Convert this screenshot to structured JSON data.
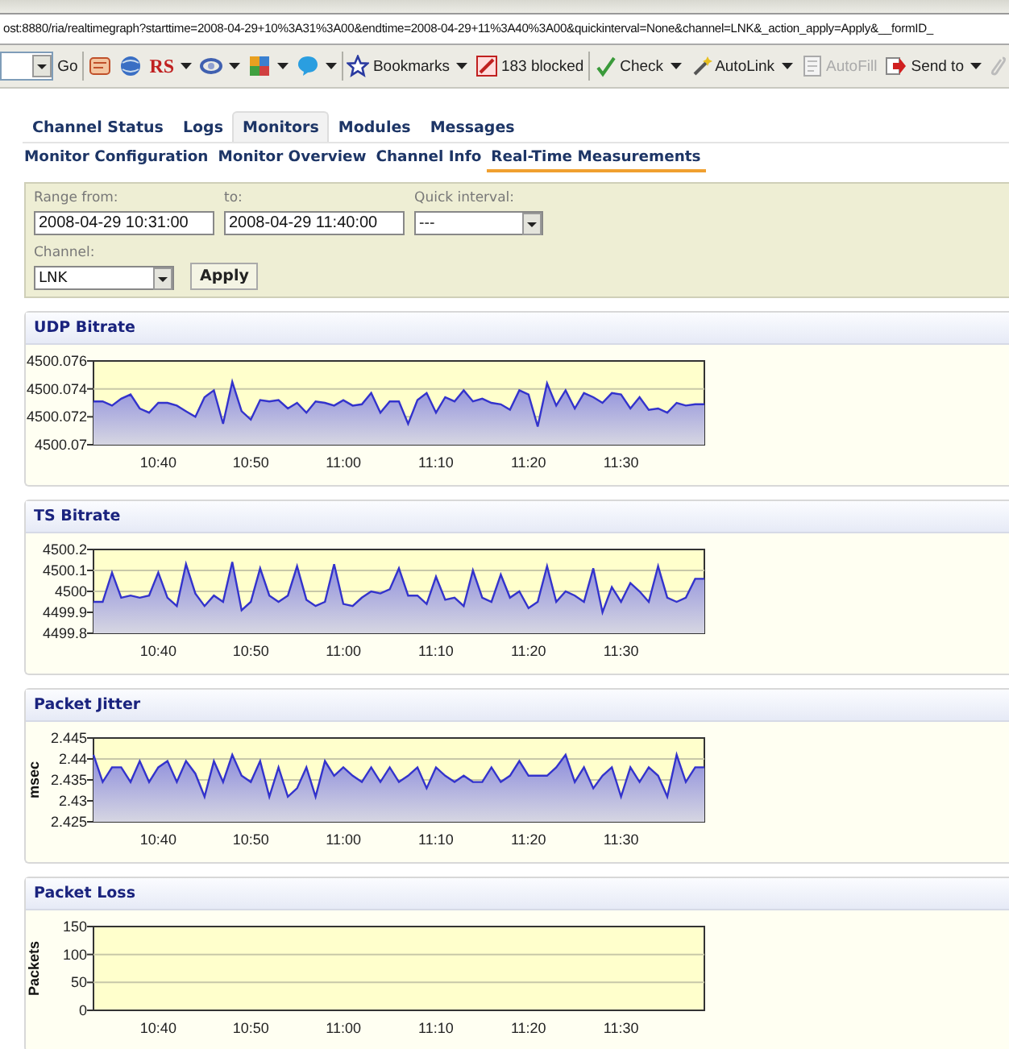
{
  "browser": {
    "address": "ost:8880/ria/realtimegraph?starttime=2008-04-29+10%3A31%3A00&endtime=2008-04-29+11%3A40%3A00&quickinterval=None&channel=LNK&_action_apply=Apply&__formID_",
    "toolbar": {
      "go": "Go",
      "rs": "RS",
      "bookmarks": "Bookmarks",
      "blocked": "183 blocked",
      "check": "Check",
      "autolink": "AutoLink",
      "autofill": {
        "label": "AutoFill",
        "disabled": true
      },
      "send_to": "Send to"
    }
  },
  "tabs": [
    {
      "label": "Channel Status",
      "selected": false
    },
    {
      "label": "Logs",
      "selected": false
    },
    {
      "label": "Monitors",
      "selected": true
    },
    {
      "label": "Modules",
      "selected": false
    },
    {
      "label": "Messages",
      "selected": false
    }
  ],
  "subtabs": [
    {
      "label": "Monitor Configuration",
      "selected": false
    },
    {
      "label": "Monitor Overview",
      "selected": false
    },
    {
      "label": "Channel Info",
      "selected": false
    },
    {
      "label": "Real-Time Measurements",
      "selected": true
    }
  ],
  "filter": {
    "range_from": {
      "label": "Range from:",
      "value": "2008-04-29 10:31:00"
    },
    "to": {
      "label": "to:",
      "value": "2008-04-29 11:40:00"
    },
    "quick_interval": {
      "label": "Quick interval:",
      "value": "---"
    },
    "channel": {
      "label": "Channel:",
      "value": "LNK"
    },
    "apply": "Apply"
  },
  "panels": [
    {
      "title": "UDP Bitrate",
      "chart_data": {
        "type": "area",
        "categories": [
          null,
          null,
          null,
          null,
          null,
          null,
          null,
          "10:40",
          null,
          null,
          null,
          null,
          null,
          null,
          null,
          null,
          null,
          "10:50",
          null,
          null,
          null,
          null,
          null,
          null,
          null,
          null,
          null,
          "11:00",
          null,
          null,
          null,
          null,
          null,
          null,
          null,
          null,
          null,
          "11:10",
          null,
          null,
          null,
          null,
          null,
          null,
          null,
          null,
          null,
          "11:20",
          null,
          null,
          null,
          null,
          null,
          null,
          null,
          null,
          null,
          "11:30",
          null,
          null,
          null,
          null,
          null,
          null,
          null,
          null,
          null
        ],
        "ylim": [
          4500.07,
          4500.076
        ],
        "yticks": [
          4500.07,
          4500.072,
          4500.074,
          4500.076
        ],
        "series": [
          {
            "color": "#3333cc",
            "values": [
              4500.0731,
              4500.0731,
              4500.0728,
              4500.0733,
              4500.0736,
              4500.0726,
              4500.0723,
              4500.073,
              4500.073,
              4500.0728,
              4500.0724,
              4500.072,
              4500.0734,
              4500.0739,
              4500.0715,
              4500.0745,
              4500.0724,
              4500.0718,
              4500.0732,
              4500.0731,
              4500.0732,
              4500.0726,
              4500.073,
              4500.0723,
              4500.0731,
              4500.073,
              4500.0728,
              4500.0732,
              4500.0728,
              4500.0729,
              4500.0737,
              4500.0723,
              4500.0731,
              4500.0731,
              4500.0715,
              4500.0732,
              4500.0737,
              4500.0723,
              4500.0734,
              4500.0731,
              4500.0739,
              4500.0731,
              4500.0733,
              4500.073,
              4500.0729,
              4500.0725,
              4500.0739,
              4500.0736,
              4500.0713,
              4500.0744,
              4500.0728,
              4500.0739,
              4500.0726,
              4500.0737,
              4500.0734,
              4500.073,
              4500.0737,
              4500.0736,
              4500.0726,
              4500.0734,
              4500.0725,
              4500.0726,
              4500.0723,
              4500.073,
              4500.0728,
              4500.0729,
              4500.0729
            ]
          }
        ]
      }
    },
    {
      "title": "TS Bitrate",
      "chart_data": {
        "type": "area",
        "categories": [
          null,
          null,
          null,
          null,
          null,
          null,
          null,
          "10:40",
          null,
          null,
          null,
          null,
          null,
          null,
          null,
          null,
          null,
          "10:50",
          null,
          null,
          null,
          null,
          null,
          null,
          null,
          null,
          null,
          "11:00",
          null,
          null,
          null,
          null,
          null,
          null,
          null,
          null,
          null,
          "11:10",
          null,
          null,
          null,
          null,
          null,
          null,
          null,
          null,
          null,
          "11:20",
          null,
          null,
          null,
          null,
          null,
          null,
          null,
          null,
          null,
          "11:30",
          null,
          null,
          null,
          null,
          null,
          null,
          null,
          null,
          null
        ],
        "ylim": [
          4499.8,
          4500.2
        ],
        "yticks": [
          4499.8,
          4499.9,
          4500,
          4500.1,
          4500.2
        ],
        "series": [
          {
            "color": "#3333cc",
            "values": [
              4499.95,
              4499.95,
              4500.09,
              4499.97,
              4499.98,
              4499.97,
              4499.98,
              4500.09,
              4499.97,
              4499.93,
              4500.13,
              4499.99,
              4499.93,
              4499.98,
              4499.95,
              4500.14,
              4499.91,
              4499.95,
              4500.11,
              4499.98,
              4499.95,
              4499.98,
              4500.12,
              4499.96,
              4499.93,
              4499.95,
              4500.13,
              4499.94,
              4499.93,
              4499.97,
              4500,
              4499.99,
              4500.01,
              4500.11,
              4499.98,
              4499.98,
              4499.94,
              4500.07,
              4499.96,
              4499.97,
              4499.93,
              4500.1,
              4499.97,
              4499.95,
              4500.08,
              4499.97,
              4500,
              4499.92,
              4499.95,
              4500.12,
              4499.95,
              4500,
              4499.98,
              4499.95,
              4500.11,
              4499.9,
              4500.02,
              4499.95,
              4500.04,
              4500,
              4499.95,
              4500.12,
              4499.97,
              4499.95,
              4499.97,
              4500.06,
              4500.06
            ]
          }
        ]
      }
    },
    {
      "title": "Packet Jitter",
      "chart_data": {
        "type": "area",
        "ylabel": "msec",
        "categories": [
          null,
          null,
          null,
          null,
          null,
          null,
          null,
          "10:40",
          null,
          null,
          null,
          null,
          null,
          null,
          null,
          null,
          null,
          "10:50",
          null,
          null,
          null,
          null,
          null,
          null,
          null,
          null,
          null,
          "11:00",
          null,
          null,
          null,
          null,
          null,
          null,
          null,
          null,
          null,
          "11:10",
          null,
          null,
          null,
          null,
          null,
          null,
          null,
          null,
          null,
          "11:20",
          null,
          null,
          null,
          null,
          null,
          null,
          null,
          null,
          null,
          "11:30",
          null,
          null,
          null,
          null,
          null,
          null,
          null,
          null,
          null
        ],
        "ylim": [
          2.425,
          2.445
        ],
        "yticks": [
          2.425,
          2.43,
          2.435,
          2.44,
          2.445
        ],
        "series": [
          {
            "color": "#3333cc",
            "values": [
              2.441,
              2.4345,
              2.438,
              2.438,
              2.4345,
              2.4395,
              2.4345,
              2.438,
              2.4395,
              2.4345,
              2.4395,
              2.4365,
              2.431,
              2.4395,
              2.4345,
              2.441,
              2.436,
              2.4345,
              2.4395,
              2.431,
              2.438,
              2.431,
              2.433,
              2.438,
              2.431,
              2.4395,
              2.436,
              2.438,
              2.436,
              2.4345,
              2.438,
              2.4345,
              2.438,
              2.4345,
              2.436,
              2.438,
              2.433,
              2.438,
              2.436,
              2.4345,
              2.436,
              2.4345,
              2.4345,
              2.438,
              2.4345,
              2.436,
              2.4395,
              2.436,
              2.436,
              2.436,
              2.438,
              2.441,
              2.4345,
              2.438,
              2.433,
              2.436,
              2.438,
              2.431,
              2.438,
              2.4345,
              2.438,
              2.436,
              2.431,
              2.441,
              2.4345,
              2.438,
              2.438
            ]
          }
        ]
      }
    },
    {
      "title": "Packet Loss",
      "chart_data": {
        "type": "area",
        "ylabel": "Packets",
        "categories": [
          null,
          null,
          null,
          null,
          null,
          null,
          null,
          "10:40",
          null,
          null,
          null,
          null,
          null,
          null,
          null,
          null,
          null,
          "10:50",
          null,
          null,
          null,
          null,
          null,
          null,
          null,
          null,
          null,
          "11:00",
          null,
          null,
          null,
          null,
          null,
          null,
          null,
          null,
          null,
          "11:10",
          null,
          null,
          null,
          null,
          null,
          null,
          null,
          null,
          null,
          "11:20",
          null,
          null,
          null,
          null,
          null,
          null,
          null,
          null,
          null,
          "11:30",
          null,
          null,
          null,
          null,
          null,
          null,
          null,
          null,
          null
        ],
        "ylim": [
          0,
          150
        ],
        "yticks": [
          0,
          50,
          100,
          150
        ]
      }
    }
  ]
}
